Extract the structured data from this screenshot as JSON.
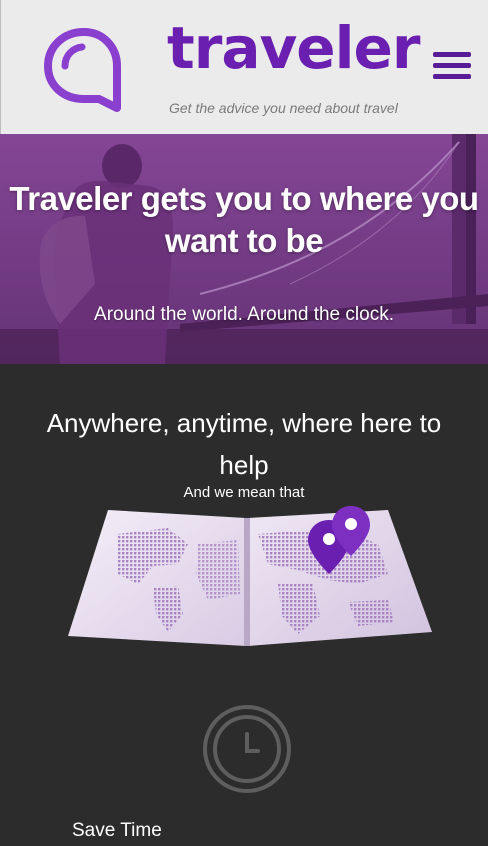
{
  "header": {
    "brand": "traveler",
    "tagline": "Get the advice you need about travel",
    "logo_icon": "speech-bubble-icon",
    "menu_icon": "hamburger-menu-icon",
    "brand_color": "#6a1fb0"
  },
  "hero": {
    "title": "Traveler gets you to where you want to be",
    "subtitle": "Around the world. Around the clock."
  },
  "section": {
    "title": "Anywhere, anytime, where here to help",
    "subtitle": "And we mean that",
    "map_icon": "world-map-with-pins-icon",
    "feature_icon": "clock-icon",
    "feature_label": "Save Time"
  }
}
